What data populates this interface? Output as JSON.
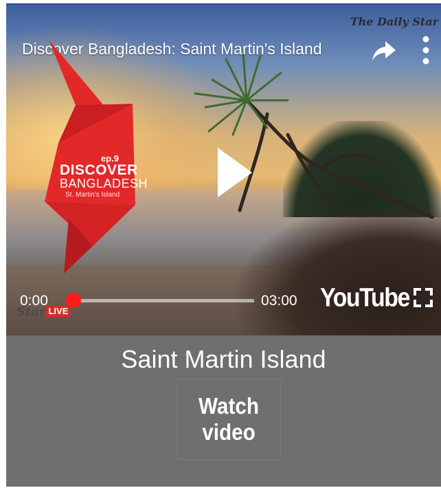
{
  "player": {
    "title": "Discover Bangladesh: Saint Martin's Island",
    "watermark": "The Daily Star",
    "time_current": "0:00",
    "time_total": "03:00",
    "progress": 0.0,
    "brand": "YouTube",
    "icons": {
      "share": "share-arrow-icon",
      "more": "vertical-dots-icon",
      "play": "play-icon",
      "fullscreen": "fullscreen-icon"
    },
    "accent_color": "#ff0000"
  },
  "logo": {
    "episode": "ep.9",
    "word1": "DISCOVER",
    "word2": "BANGLADESH",
    "place": "St. Martin's Island"
  },
  "bug": {
    "star": "Star",
    "live": "LIVE"
  },
  "panel": {
    "caption": "Saint Martin Island",
    "watch_label": "Watch video"
  }
}
